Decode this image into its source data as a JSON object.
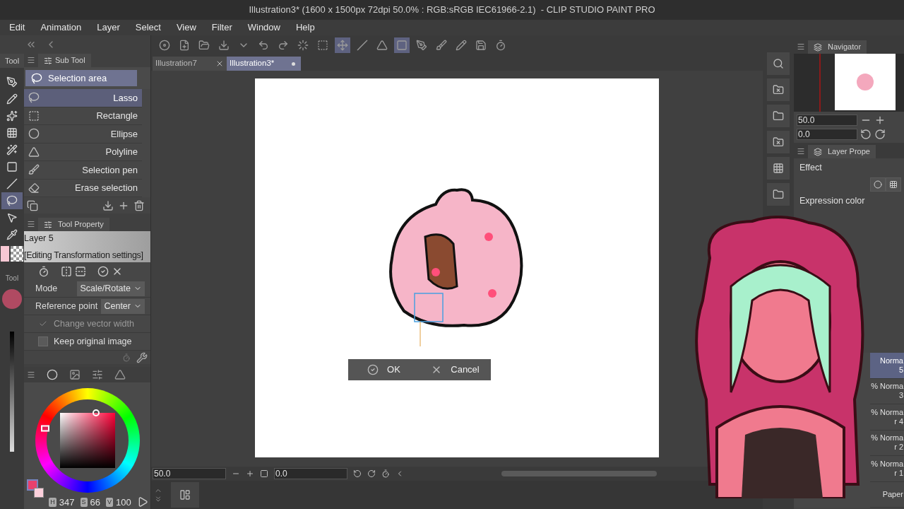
{
  "window": {
    "title": "Illustration3* (1600 x 1500px 72dpi 50.0% : RGB:sRGB IEC61966-2.1)  - CLIP STUDIO PAINT PRO"
  },
  "menu": [
    "Edit",
    "Animation",
    "Layer",
    "Select",
    "View",
    "Filter",
    "Window",
    "Help"
  ],
  "toolbar": [
    {
      "selected": false
    },
    {
      "selected": false
    },
    {
      "selected": false
    },
    {
      "selected": false
    },
    {
      "selected": false
    },
    {
      "selected": false
    },
    {
      "selected": false
    },
    {
      "selected": false
    },
    {
      "selected": false
    },
    {
      "selected": true
    },
    {
      "selected": false
    },
    {
      "selected": false
    },
    {
      "selected": true
    },
    {
      "selected": false
    },
    {
      "selected": false
    },
    {
      "selected": false
    },
    {
      "selected": false
    },
    {
      "selected": false
    }
  ],
  "tabs": [
    {
      "label": "Illustration7",
      "selected": false
    },
    {
      "label": "Illustration3*",
      "selected": true
    }
  ],
  "tool_palette": {
    "tab": "Tool",
    "label": "Tool",
    "tools": [
      {
        "selected": false
      },
      {
        "selected": false
      },
      {
        "selected": false
      },
      {
        "selected": false
      },
      {
        "selected": false
      },
      {
        "selected": false
      },
      {
        "selected": false
      },
      {
        "selected": true
      },
      {
        "selected": false
      },
      {
        "selected": false
      }
    ]
  },
  "sub_tool": {
    "tab": "Sub Tool",
    "group": "Selection area",
    "items": [
      {
        "label": "Lasso",
        "selected": true
      },
      {
        "label": "Rectangle",
        "selected": false
      },
      {
        "label": "Ellipse",
        "selected": false
      },
      {
        "label": "Polyline",
        "selected": false
      },
      {
        "label": "Selection pen",
        "selected": false
      },
      {
        "label": "Erase selection",
        "selected": false
      }
    ]
  },
  "tool_property": {
    "tab": "Tool Property",
    "layer": "Layer 5",
    "status": "[Editing Transformation settings]",
    "settings": [
      {
        "kind": "select",
        "label": "Mode",
        "value": "Scale/Rotate"
      },
      {
        "kind": "select",
        "label": "Reference point",
        "value": "Center"
      },
      {
        "kind": "checkbox",
        "label": "Change vector width",
        "checked": true,
        "disabled": true
      },
      {
        "kind": "checkbox",
        "label": "Keep original image",
        "checked": false,
        "disabled": false
      }
    ]
  },
  "color": {
    "channels": [
      {
        "label": "H",
        "value": "347"
      },
      {
        "label": "S",
        "value": "66"
      },
      {
        "label": "V",
        "value": "100"
      }
    ]
  },
  "transform_bar": {
    "ok": "OK",
    "cancel": "Cancel"
  },
  "canvas_controls": {
    "zoom": "50.0",
    "rotation": "0.0"
  },
  "navigator": {
    "tab": "Navigator",
    "zoom": "50.0",
    "rotation": "0.0"
  },
  "layer_property": {
    "tab": "Layer Prope",
    "effect": "Effect",
    "expression_color": "Expression color"
  },
  "layers": [
    {
      "blend": "Norma",
      "name": "5",
      "selected": true
    },
    {
      "blend": "% Norma",
      "name": "3",
      "selected": false
    },
    {
      "blend": "% Norma",
      "name": "r 4",
      "selected": false
    },
    {
      "blend": "% Norma",
      "name": "r 2",
      "selected": false
    },
    {
      "blend": "% Norma",
      "name": "r 1",
      "selected": false
    },
    {
      "name": "Paper",
      "selected": false
    }
  ]
}
